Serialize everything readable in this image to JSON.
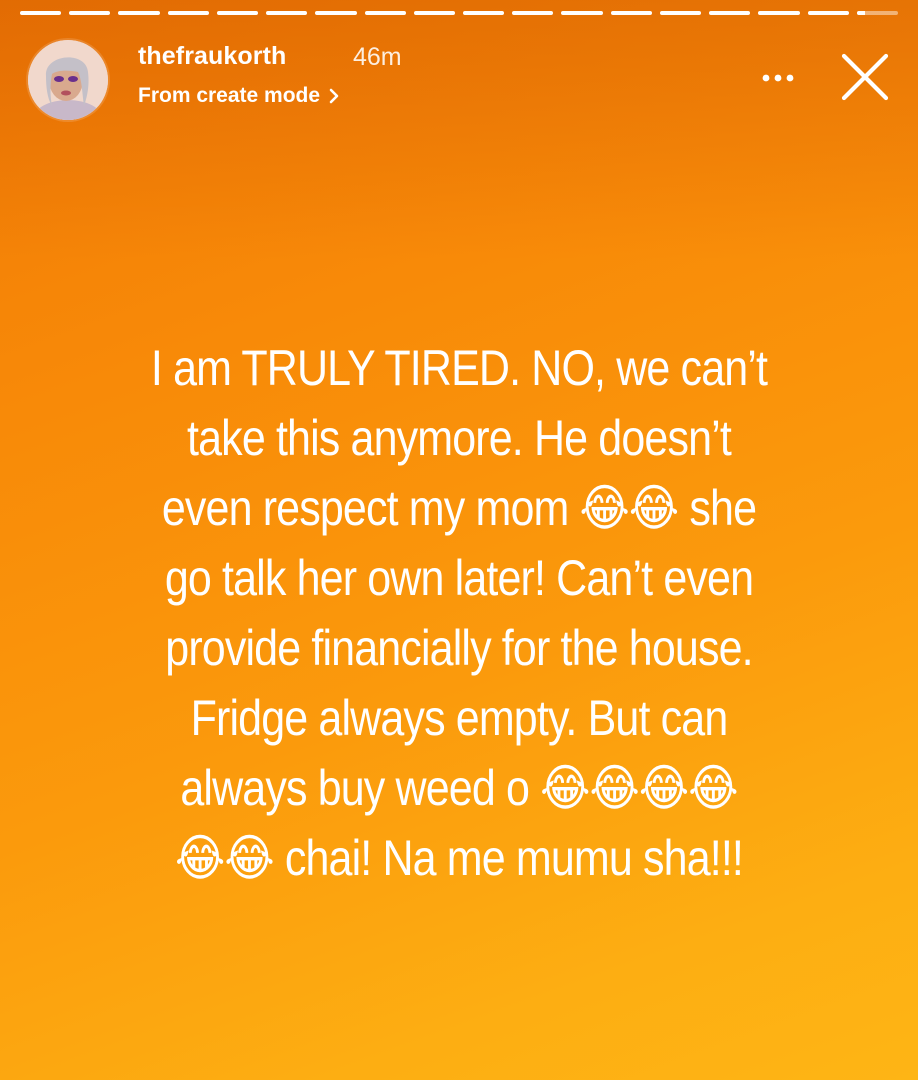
{
  "progress": {
    "segments": [
      1,
      1,
      1,
      1,
      1,
      1,
      1,
      1,
      1,
      1,
      1,
      1,
      1,
      1,
      1,
      1,
      1,
      1
    ],
    "completed_count": 17
  },
  "header": {
    "username": "thefraukorth",
    "time_ago": "46m",
    "subtitle": "From create mode"
  },
  "story": {
    "text": "I am TRULY TIRED. NO, we can’t take this anymore. He doesn’t even respect my mom 😂😂 she go talk her own later! Can’t even provide financially for the house. Fridge always empty. But can always buy weed o 😂😂😂😂 😂😂 chai! Na me mumu sha!!!"
  },
  "icons": {
    "more": "more-options-icon",
    "close": "close-icon",
    "chevron": "chevron-right-icon"
  },
  "colors": {
    "background_top": "#f07a05",
    "background_bottom": "#feb515",
    "text": "#ffffff"
  }
}
